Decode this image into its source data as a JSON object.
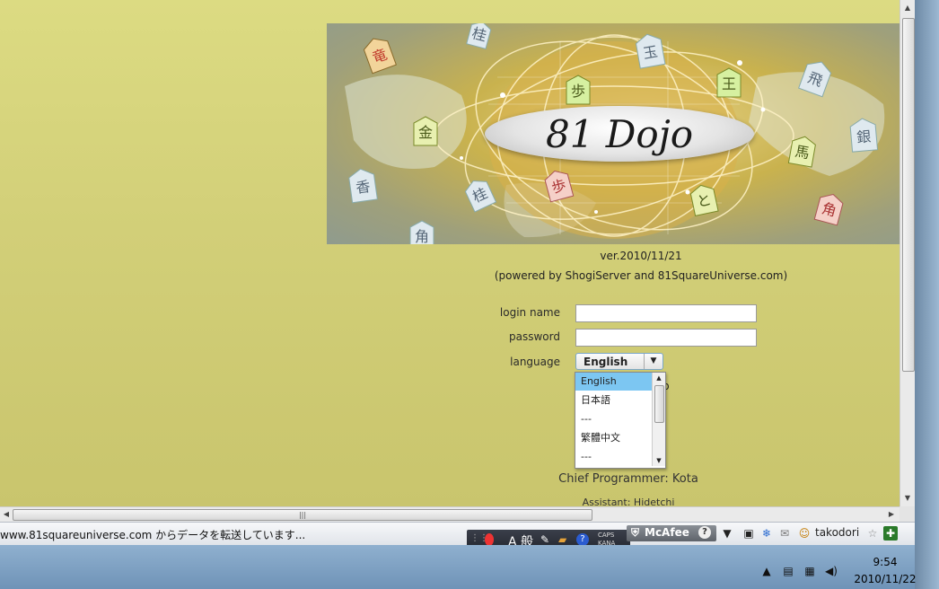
{
  "banner": {
    "title": "81 Dojo"
  },
  "page": {
    "version": "ver.2010/11/21",
    "powered_by": "(powered by ShogiServer and 81SquareUniverse.com)",
    "chief_programmer": "Chief Programmer: Kota",
    "assistant": "Assistant: Hidetchi",
    "partially_hidden": "p"
  },
  "form": {
    "login_label": "login name",
    "login_value": "",
    "password_label": "password",
    "password_value": "",
    "language_label": "language",
    "language_selected": "English",
    "language_options": [
      "English",
      "日本語",
      "---",
      "繁體中文",
      "---"
    ]
  },
  "statusbar": {
    "text": "www.81squareuniverse.com からデータを転送しています...",
    "ime_mode": "A 般",
    "caps": "CAPS",
    "kana": "KANA",
    "mcafee": "McAfee",
    "user": "takodori"
  },
  "taskbar": {
    "time": "9:54",
    "date": "2010/11/22"
  }
}
